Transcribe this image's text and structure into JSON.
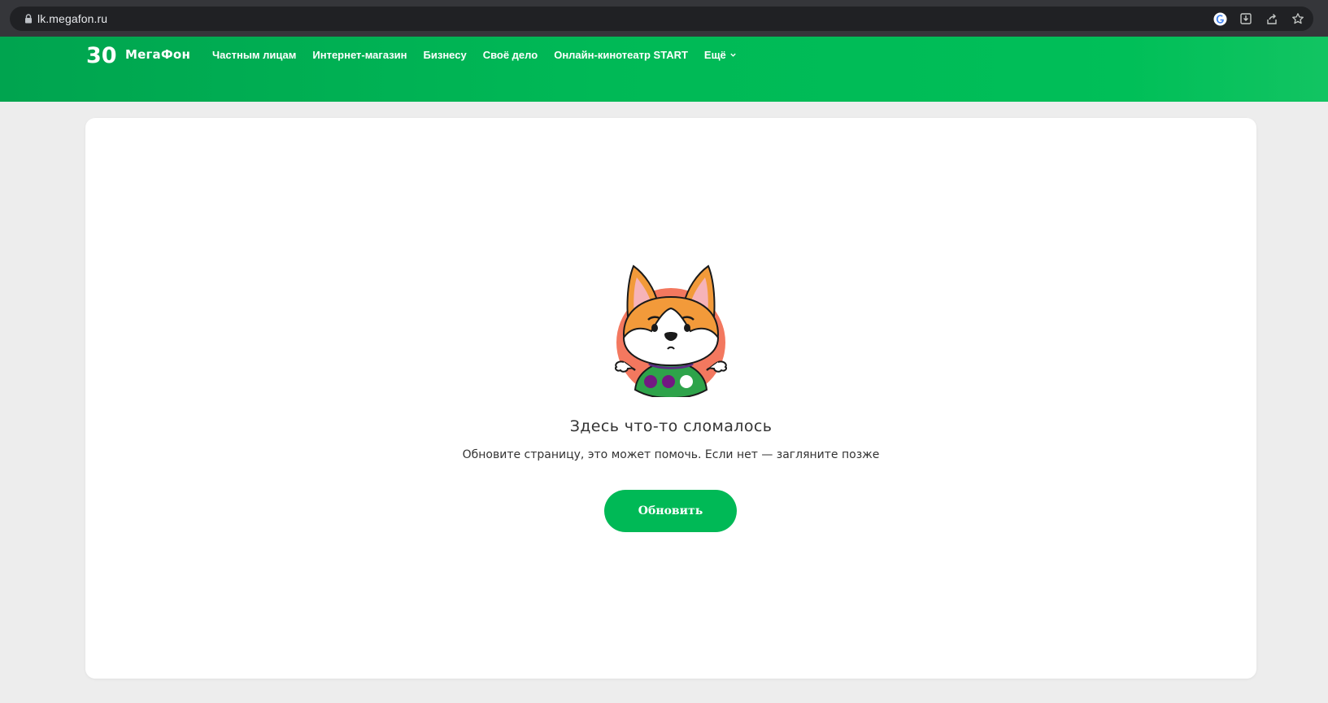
{
  "browser": {
    "url": "lk.megafon.ru",
    "icons": [
      "lock-icon",
      "google-icon",
      "install-icon",
      "share-icon",
      "bookmark-star-icon"
    ]
  },
  "header": {
    "logo_number": "30",
    "logo_text": "МегаФон",
    "nav": [
      "Частным лицам",
      "Интернет-магазин",
      "Бизнесу",
      "Своё дело",
      "Онлайн-кинотеатр START",
      "Ещё"
    ]
  },
  "error": {
    "title": "Здесь что-то сломалось",
    "subtitle": "Обновите страницу, это может помочь. Если нет — загляните позже",
    "button_label": "Обновить"
  },
  "colors": {
    "brand_green": "#00b956",
    "brand_purple": "#731982",
    "page_background": "#ededed",
    "browser_bar": "#35363a"
  }
}
